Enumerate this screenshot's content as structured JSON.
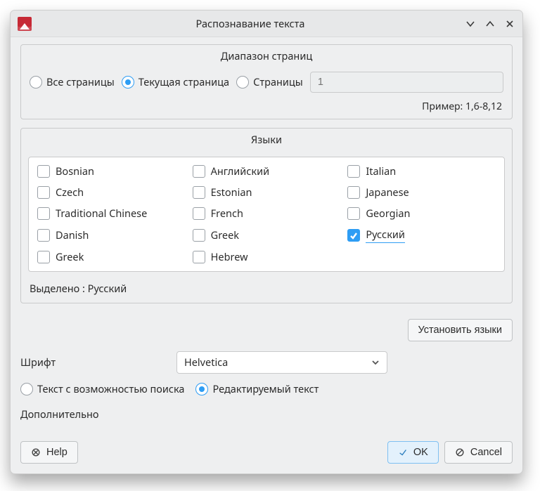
{
  "title": "Распознавание текста",
  "page_range": {
    "group_title": "Диапазон страниц",
    "all": "Все страницы",
    "current": "Текущая страница",
    "pages": "Страницы",
    "input_placeholder": "1",
    "example": "Пример: 1,6-8,12",
    "selected": "current"
  },
  "languages": {
    "group_title": "Языки",
    "items": [
      {
        "label": "Bosnian",
        "checked": false
      },
      {
        "label": "Английский",
        "checked": false
      },
      {
        "label": "Italian",
        "checked": false
      },
      {
        "label": "Czech",
        "checked": false
      },
      {
        "label": "Estonian",
        "checked": false
      },
      {
        "label": "Japanese",
        "checked": false
      },
      {
        "label": "Traditional Chinese",
        "checked": false
      },
      {
        "label": "French",
        "checked": false
      },
      {
        "label": "Georgian",
        "checked": false
      },
      {
        "label": "Danish",
        "checked": false
      },
      {
        "label": "Greek",
        "checked": false
      },
      {
        "label": "Русский",
        "checked": true
      },
      {
        "label": "Greek",
        "checked": false
      },
      {
        "label": "Hebrew",
        "checked": false
      }
    ],
    "selected_prefix": "Выделено : ",
    "selected_value": "Русский",
    "install_btn": "Установить языки"
  },
  "font": {
    "label": "Шрифт",
    "value": "Helvetica"
  },
  "text_type": {
    "searchable": "Текст с возможностью поиска",
    "editable": "Редактируемый текст",
    "selected": "editable"
  },
  "advanced": "Дополнительно",
  "buttons": {
    "help": "Help",
    "ok": "OK",
    "cancel": "Cancel"
  }
}
